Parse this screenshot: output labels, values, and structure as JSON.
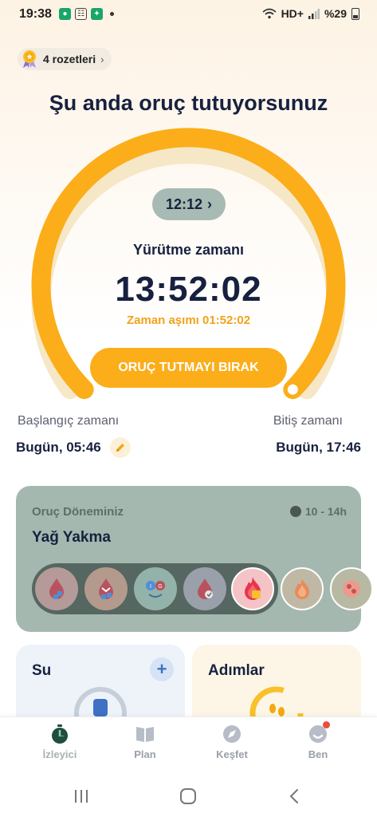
{
  "status_bar": {
    "time": "19:38",
    "network": "HD+",
    "battery": "%29"
  },
  "badges": {
    "label": "4 rozetleri"
  },
  "title": "Şu anda oruç tutuyorsunuz",
  "timer": {
    "plan": "12:12",
    "elapsed_label": "Yürütme zamanı",
    "elapsed": "13:52:02",
    "overtime": "Zaman aşımı 01:52:02",
    "progress": 1.0,
    "accent": "#fbae1a",
    "stop_label": "ORUÇ TUTMAYI BIRAK"
  },
  "schedule": {
    "start_label": "Başlangıç zamanı",
    "start_value": "Bugün, 05:46",
    "end_label": "Bitiş zamanı",
    "end_value": "Bugün, 17:46"
  },
  "phase": {
    "title": "Oruç Döneminiz",
    "range": "10 - 14h",
    "name": "Yağ Yakma",
    "stages": [
      "blood-sugar-rise-icon",
      "blood-sugar-fall-icon",
      "glucose-switch-icon",
      "insulin-drop-icon",
      "fat-burning-icon",
      "ketosis-icon",
      "autophagy-icon"
    ],
    "current_stage_index": 4
  },
  "water": {
    "title": "Su"
  },
  "steps": {
    "title": "Adımlar"
  },
  "nav": {
    "tracker": "İzleyici",
    "plan": "Plan",
    "explore": "Keşfet",
    "me": "Ben"
  }
}
